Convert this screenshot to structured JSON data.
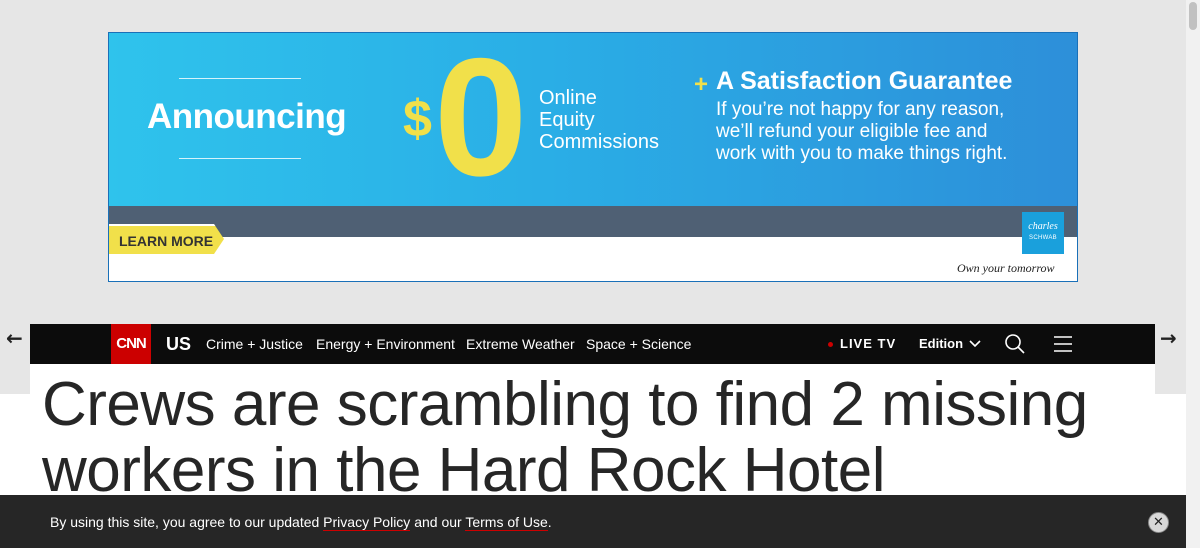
{
  "ad": {
    "announcing": "Announcing",
    "dollar": "$",
    "zero": "0",
    "online_lines": [
      "Online",
      "Equity",
      "Commissions"
    ],
    "plus": "+",
    "guarantee_title": "A Satisfaction Guarantee",
    "guarantee_lines": [
      "If you’re not happy for any reason,",
      "we’ll refund your eligible fee and",
      "work with you to make things right."
    ],
    "learn_more": "LEARN MORE",
    "schwab_top": "charles",
    "schwab_bottom": "SCHWAB",
    "tagline": "Own your tomorrow"
  },
  "header": {
    "logo": "CNN",
    "section": "US",
    "nav": [
      "Crime + Justice",
      "Energy + Environment",
      "Extreme Weather",
      "Space + Science"
    ],
    "live_tv": "LIVE TV",
    "edition": "Edition"
  },
  "article": {
    "headline": "Crews are scrambling to find 2 missing workers in the Hard Rock Hotel"
  },
  "cookie_bar": {
    "prefix": "By using this site, you agree to our updated ",
    "privacy_link": "Privacy Policy",
    "middle": " and our ",
    "terms_link": "Terms of Use",
    "suffix": ".",
    "close": "✕"
  },
  "colors": {
    "cnn_red": "#cc0000",
    "ad_blue": "#2aaee6",
    "ad_yellow": "#f1e04a",
    "header_bg": "#0c0c0c"
  },
  "icons": [
    "arrow-left-icon",
    "arrow-right-icon",
    "search-icon",
    "hamburger-menu-icon",
    "chevron-down-icon",
    "close-icon"
  ]
}
